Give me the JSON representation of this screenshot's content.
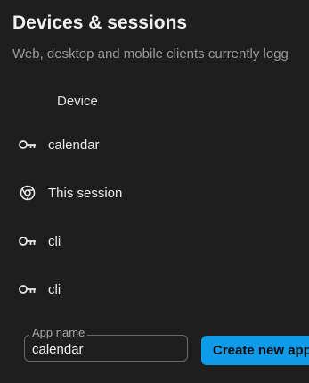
{
  "header": {
    "title": "Devices & sessions",
    "subtitle": "Web, desktop and mobile clients currently logg"
  },
  "table": {
    "column_device": "Device",
    "rows": [
      {
        "icon": "key-icon",
        "label": "calendar"
      },
      {
        "icon": "chrome-icon",
        "label": "This session"
      },
      {
        "icon": "key-icon",
        "label": "cli"
      },
      {
        "icon": "key-icon",
        "label": "cli"
      }
    ]
  },
  "form": {
    "app_name_label": "App name",
    "app_name_value": "calendar",
    "create_button_label": "Create new app"
  },
  "colors": {
    "background": "#1e1e1e",
    "accent": "#0d9bea",
    "muted_text": "#9a9a9a"
  }
}
